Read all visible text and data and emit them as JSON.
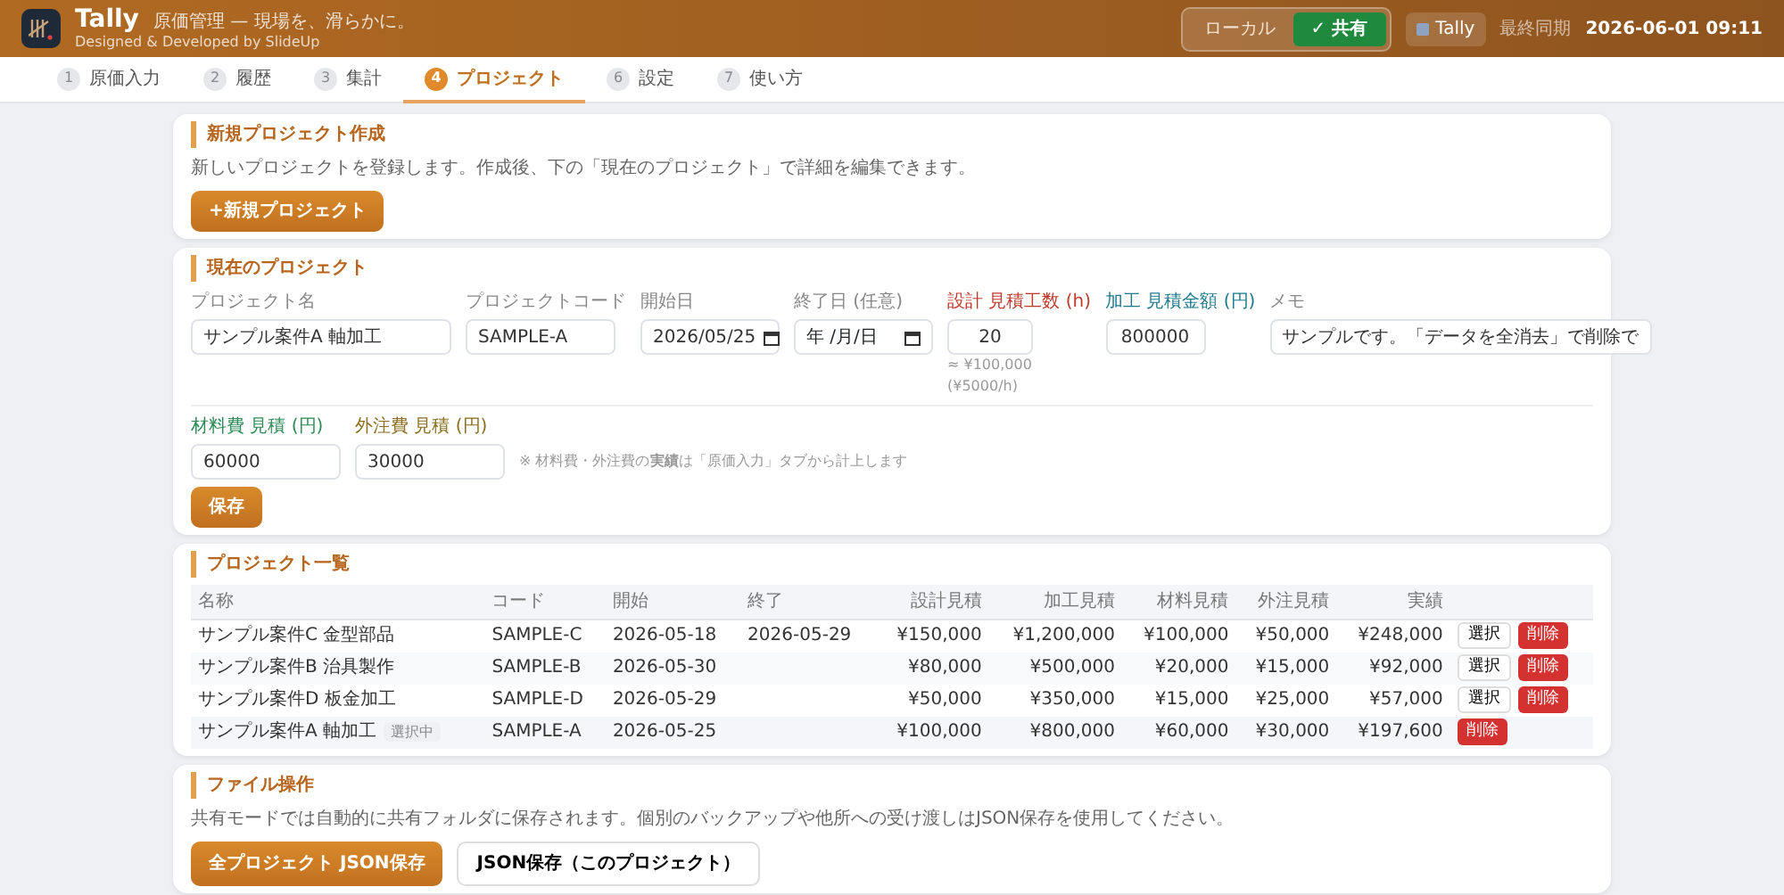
{
  "header": {
    "title": "Tally",
    "tagline": "原価管理 — 現場を、滑らかに。",
    "credit": "Designed & Developed by SlideUp",
    "mode_toggle": [
      {
        "label": "ローカル",
        "selected": false
      },
      {
        "label": "✓ 共有",
        "selected": true
      }
    ],
    "user_chip": "Tally",
    "sync_label": "最終同期",
    "sync_time": "2026-06-01 09:11"
  },
  "tabs": [
    {
      "number": "1",
      "label": "原価入力",
      "selected": false
    },
    {
      "number": "2",
      "label": "履歴",
      "selected": false
    },
    {
      "number": "3",
      "label": "集計",
      "selected": false
    },
    {
      "number": "4",
      "label": "プロジェクト",
      "selected": true
    },
    {
      "number": "6",
      "label": "設定",
      "selected": false
    },
    {
      "number": "7",
      "label": "使い方",
      "selected": false
    }
  ],
  "new_project": {
    "title": "新規プロジェクト作成",
    "description": "新しいプロジェクトを登録します。作成後、下の「現在のプロジェクト」で詳細を編集できます。",
    "button": "+新規プロジェクト"
  },
  "current_project": {
    "title": "現在のプロジェクト",
    "fields": [
      {
        "kind": "text",
        "label": "プロジェクト名",
        "value": "サンプル案件A 軸加工"
      },
      {
        "kind": "text",
        "label": "プロジェクトコード",
        "value": "SAMPLE-A"
      },
      {
        "kind": "date",
        "label": "開始日",
        "value": "2026/05/25"
      },
      {
        "kind": "date",
        "label": "終了日 (任意)",
        "placeholder": "年 /月/日"
      },
      {
        "kind": "number",
        "label": "設計 見積工数 (h)",
        "color": "#c0392b",
        "value": "20",
        "hint": "≈ ¥100,000 (¥5000/h)"
      },
      {
        "kind": "number",
        "label": "加工 見積金額 (円)",
        "color": "#1f7a8c",
        "value": "800000"
      },
      {
        "kind": "text",
        "label": "メモ",
        "value": "サンプルです。「データを全消去」で削除で"
      }
    ],
    "cost_fields": [
      {
        "label": "材料費 見積 (円)",
        "color": "#2e8b57",
        "value": "60000"
      },
      {
        "label": "外注費 見積 (円)",
        "color": "#8a6d1f",
        "value": "30000"
      }
    ],
    "note": "※ 材料費・外注費の**実績**は「原価入力」タブから計上します",
    "save_button": "保存"
  },
  "project_list": {
    "title": "プロジェクト一覧",
    "columns": [
      "名称",
      "コード",
      "開始",
      "終了",
      "設計見積",
      "加工見積",
      "材料見積",
      "外注見積",
      "実績"
    ],
    "rows": [
      {
        "selected": false,
        "cells": [
          "サンプル案件C 金型部品",
          "SAMPLE-C",
          "2026-05-18",
          "2026-05-29",
          "¥150,000",
          "¥1,200,000",
          "¥100,000",
          "¥50,000",
          "¥248,000"
        ],
        "actions": [
          {
            "kind": "select",
            "label": "選択"
          },
          {
            "kind": "delete",
            "label": "削除"
          }
        ]
      },
      {
        "selected": false,
        "cells": [
          "サンプル案件B 治具製作",
          "SAMPLE-B",
          "2026-05-30",
          "",
          "¥80,000",
          "¥500,000",
          "¥20,000",
          "¥15,000",
          "¥92,000"
        ],
        "actions": [
          {
            "kind": "select",
            "label": "選択"
          },
          {
            "kind": "delete",
            "label": "削除"
          }
        ]
      },
      {
        "selected": false,
        "cells": [
          "サンプル案件D 板金加工",
          "SAMPLE-D",
          "2026-05-29",
          "",
          "¥50,000",
          "¥350,000",
          "¥15,000",
          "¥25,000",
          "¥57,000"
        ],
        "actions": [
          {
            "kind": "select",
            "label": "選択"
          },
          {
            "kind": "delete",
            "label": "削除"
          }
        ]
      },
      {
        "selected": true,
        "badge": "選択中",
        "cells": [
          "サンプル案件A 軸加工",
          "SAMPLE-A",
          "2026-05-25",
          "",
          "¥100,000",
          "¥800,000",
          "¥60,000",
          "¥30,000",
          "¥197,600"
        ],
        "actions": [
          {
            "kind": "delete",
            "label": "削除"
          }
        ]
      }
    ]
  },
  "file_ops": {
    "title": "ファイル操作",
    "description": "共有モードでは自動的に共有フォルダに保存されます。個別のバックアップや他所への受け渡しはJSON保存を使用してください。",
    "buttons": [
      {
        "kind": "primary",
        "label": "全プロジェクト JSON保存"
      },
      {
        "kind": "outline",
        "label": "JSON保存（このプロジェクト）"
      }
    ]
  }
}
